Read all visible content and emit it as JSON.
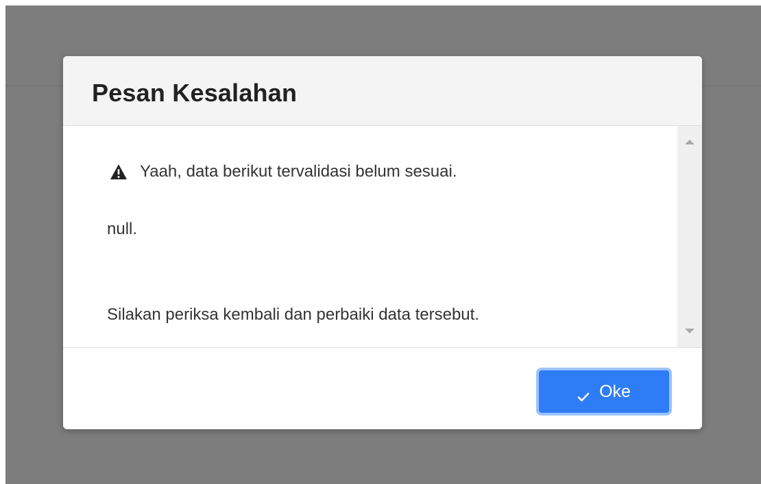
{
  "dialog": {
    "title": "Pesan Kesalahan",
    "warning_text": "Yaah, data berikut tervalidasi belum sesuai.",
    "detail_text": "null.",
    "instruction_text": "Silakan periksa kembali dan perbaiki data tersebut.",
    "ok_label": "Oke"
  },
  "icons": {
    "warning": "warning-triangle-icon",
    "confirm": "checkmark-icon",
    "scroll_up": "chevron-up-icon",
    "scroll_down": "chevron-down-icon"
  },
  "colors": {
    "overlay": "#7d7d7d",
    "header_background": "#f4f4f4",
    "primary_button": "#2e7cf6",
    "button_focus_ring": "#9cc4fb",
    "text": "#333333"
  }
}
